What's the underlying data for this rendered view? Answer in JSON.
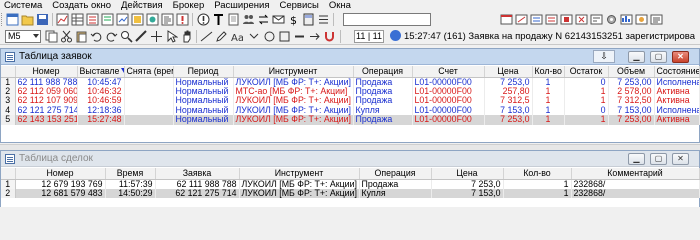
{
  "menu": [
    "Система",
    "Создать окно",
    "Действия",
    "Брокер",
    "Расширения",
    "Сервисы",
    "Окна"
  ],
  "toolbar": {
    "workspace_select": "M5",
    "search_value": "",
    "counter": "11 | 11",
    "status_message": "15:27:47 (161) Заявка на продажу N 62143153251 зарегистрирована."
  },
  "orders_window": {
    "title": "Таблица заявок",
    "pin_label": "⇩",
    "columns": [
      "Номер",
      "Выставле",
      "Снята (врем",
      "Период",
      "Инструмент",
      "Операция",
      "Счет",
      "Цена",
      "Кол-во",
      "Остаток",
      "Объем",
      "Состояние"
    ],
    "rows": [
      {
        "n": "1",
        "number": "62 111 988 788",
        "placed": "10:45:47",
        "removed": "",
        "period": "Нормальный",
        "instrument": "ЛУКОЙЛ [МБ ФР: Т+: Акции]",
        "operation": "Продажа",
        "account": "L01-00000F00",
        "price": "7 253,0",
        "qty": "1",
        "rest": "0",
        "volume": "7 253,00",
        "state": "Исполнена",
        "color": "blue"
      },
      {
        "n": "2",
        "number": "62 112 059 060",
        "placed": "10:46:32",
        "removed": "",
        "period": "Нормальный",
        "instrument": "МТС-ао [МБ ФР: Т+: Акции]",
        "operation": "Продажа",
        "account": "L01-00000F00",
        "price": "257,80",
        "qty": "1",
        "rest": "1",
        "volume": "2 578,00",
        "state": "Активна",
        "color": "red"
      },
      {
        "n": "3",
        "number": "62 112 107 909",
        "placed": "10:46:59",
        "removed": "",
        "period": "Нормальный",
        "instrument": "ЛУКОЙЛ [МБ ФР: Т+: Акции]",
        "operation": "Продажа",
        "account": "L01-00000F00",
        "price": "7 312,5",
        "qty": "1",
        "rest": "1",
        "volume": "7 312,50",
        "state": "Активна",
        "color": "red"
      },
      {
        "n": "4",
        "number": "62 121 275 714",
        "placed": "12:18:36",
        "removed": "",
        "period": "Нормальный",
        "instrument": "ЛУКОЙЛ [МБ ФР: Т+: Акции]",
        "operation": "Купля",
        "account": "L01-00000F00",
        "price": "7 153,0",
        "qty": "1",
        "rest": "0",
        "volume": "7 153,00",
        "state": "Исполнена",
        "color": "blue"
      },
      {
        "n": "5",
        "number": "62 143 153 251",
        "placed": "15:27:48",
        "removed": "",
        "period": "Нормальный",
        "instrument": "ЛУКОЙЛ [МБ ФР: Т+: Акции]",
        "operation": "Продажа",
        "account": "L01-00000F00",
        "price": "7 253,0",
        "qty": "1",
        "rest": "1",
        "volume": "7 253,00",
        "state": "Активна",
        "color": "red"
      }
    ]
  },
  "deals_window": {
    "title": "Таблица сделок",
    "columns": [
      "Номер",
      "Время",
      "Заявка",
      "Инструмент",
      "Операция",
      "Цена",
      "Кол-во",
      "Комментарий"
    ],
    "rows": [
      {
        "n": "1",
        "number": "12 679 193 769",
        "time": "11:57:39",
        "order": "62 111 988 788",
        "instrument": "ЛУКОЙЛ [МБ ФР: Т+: Акции]",
        "operation": "Продажа",
        "price": "7 253,0",
        "qty": "1",
        "comment": "232868/"
      },
      {
        "n": "2",
        "number": "12 681 579 483",
        "time": "14:50:29",
        "order": "62 121 275 714",
        "instrument": "ЛУКОЙЛ [МБ ФР: Т+: Акции]",
        "operation": "Купля",
        "price": "7 153,0",
        "qty": "1",
        "comment": "232868/"
      }
    ]
  },
  "colors": {
    "buy_sell_blue": "#1a2fd0",
    "active_red": "#d81818",
    "titlebar": "#c4d7ee"
  }
}
